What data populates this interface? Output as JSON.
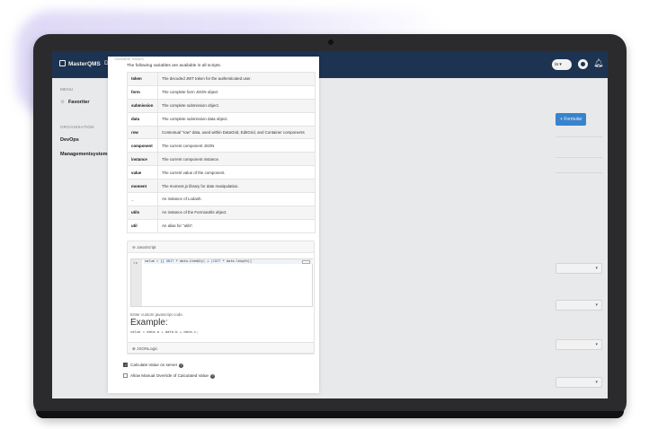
{
  "topbar": {
    "brand": "MasterQMS",
    "menu_letter": "D",
    "user_initials": "ia"
  },
  "sidebar": {
    "menu_section": "MENU",
    "favorites": "Favoriter",
    "org_section": "ORGANISATION",
    "orgs": [
      "DevOps",
      "Managementsystems"
    ]
  },
  "right_panel": {
    "button_label": "Formular"
  },
  "modal": {
    "available_title": "Available Values",
    "vars_intro": "The following variables are available in all scripts.",
    "variables": [
      {
        "name": "token",
        "desc": "The decoded JWT token for the authenticated user."
      },
      {
        "name": "form",
        "desc": "The complete form JSON object"
      },
      {
        "name": "submission",
        "desc": "The complete submission object."
      },
      {
        "name": "data",
        "desc": "The complete submission data object."
      },
      {
        "name": "row",
        "desc": "Contextual \"row\" data, used within DataGrid, EditGrid, and Container components"
      },
      {
        "name": "component",
        "desc": "The current component JSON"
      },
      {
        "name": "instance",
        "desc": "The current component instance."
      },
      {
        "name": "value",
        "desc": "The current value of the component."
      },
      {
        "name": "moment",
        "desc": "The moment.js library for date manipulation."
      },
      {
        "name": "_",
        "desc": "An instance of Lodash."
      },
      {
        "name": "utils",
        "desc": "An instance of the FormioUtils object."
      },
      {
        "name": "util",
        "desc": "An alias for \"utils\"."
      }
    ],
    "js_panel_title": "JavaScript",
    "code": {
      "line_number": "1",
      "prefix": "value = [{ ",
      "kw1": "UNIT",
      "mid": " * data.itemQty) + (",
      "kw2": "COST",
      "suffix": " * data.length)]"
    },
    "help_text": "Enter custom javascript code.",
    "example_label": "Example:",
    "example_code": "value = data.a + data.b + data.c;",
    "logic_panel_title": "JSONLogic",
    "checkbox_server": "Calculate Value on server",
    "checkbox_override": "Allow Manual Override of Calculated Value",
    "checkbox_server_checked": true,
    "checkbox_override_checked": false
  }
}
